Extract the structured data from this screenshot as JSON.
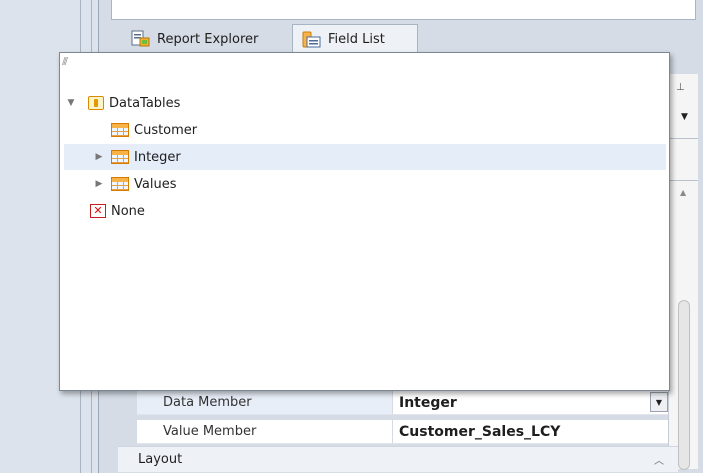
{
  "tabs": [
    {
      "label": "Report Explorer",
      "icon": "report-explorer-icon"
    },
    {
      "label": "Field List",
      "icon": "field-list-icon"
    }
  ],
  "tree": {
    "root": {
      "label": "DataTables",
      "expanded": true,
      "icon": "datasource-icon"
    },
    "children": [
      {
        "label": "Customer",
        "expandable": false,
        "selected": false,
        "icon": "table-icon"
      },
      {
        "label": "Integer",
        "expandable": true,
        "selected": true,
        "icon": "table-icon"
      },
      {
        "label": "Values",
        "expandable": true,
        "selected": false,
        "icon": "table-icon"
      }
    ],
    "none": {
      "label": "None",
      "icon": "none-icon"
    }
  },
  "properties": [
    {
      "name": "Data Member",
      "value": "Integer",
      "has_dropdown": true
    },
    {
      "name": "Value Member",
      "value": "Customer_Sales_LCY",
      "has_dropdown": false
    }
  ],
  "category": {
    "label": "Layout"
  },
  "colors": {
    "selection": "#e5edf9",
    "accent": "#f7b347",
    "border": "#7c8796"
  }
}
